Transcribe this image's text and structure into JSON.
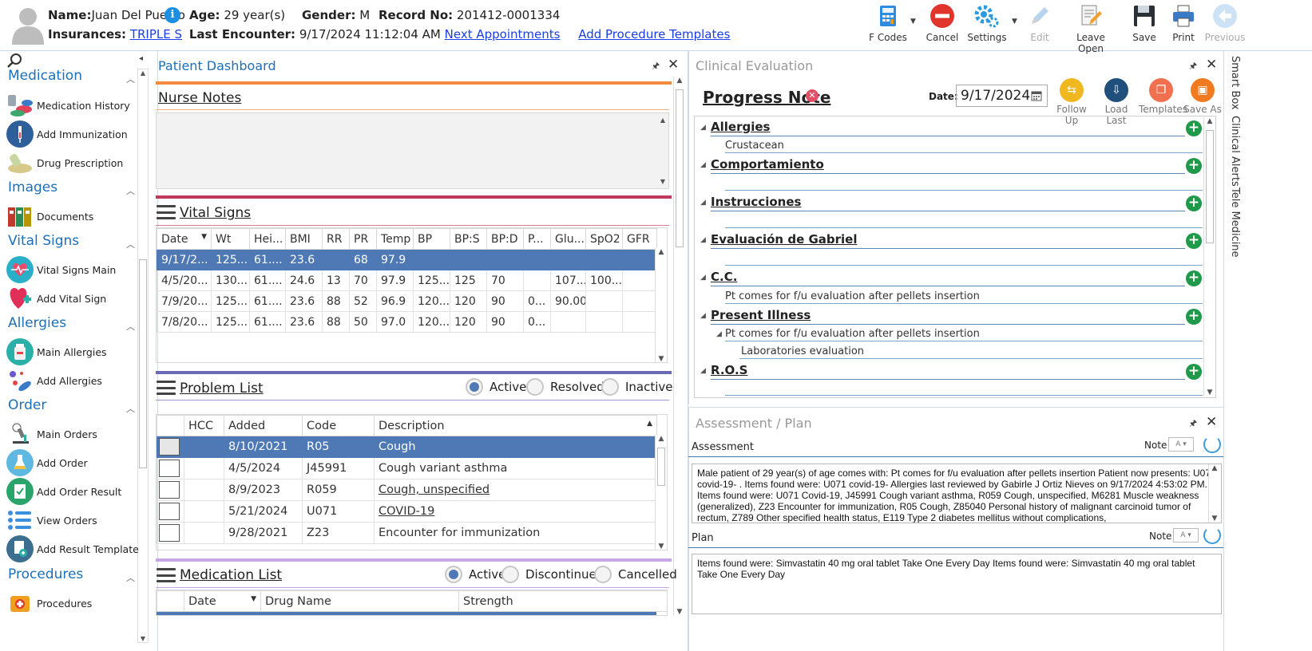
{
  "header": {
    "name_label": "Name:",
    "name": "Juan Del Pueblo",
    "age_label": "Age:",
    "age": "29 year(s)",
    "gender_label": "Gender:",
    "gender": "M",
    "record_label": "Record No:",
    "record": "201412-0001334",
    "insurances_label": "Insurances:",
    "insurance": "TRIPLE S",
    "last_encounter_label": "Last Encounter:",
    "last_encounter": "9/17/2024 11:12:04 AM",
    "next_appointments": "Next Appointments",
    "add_procedure_templates": "Add Procedure Templates"
  },
  "toolbar": {
    "fcodes": "F Codes",
    "cancel": "Cancel",
    "settings": "Settings",
    "edit": "Edit",
    "leave_open": "Leave Open",
    "save": "Save",
    "print": "Print",
    "previous": "Previous"
  },
  "sidebar": {
    "medication": {
      "title": "Medication",
      "items": [
        "Medication History",
        "Add Immunization",
        "Drug Prescription"
      ]
    },
    "images": {
      "title": "Images",
      "items": [
        "Documents"
      ]
    },
    "vital_signs": {
      "title": "Vital Signs",
      "items": [
        "Vital Signs Main",
        "Add Vital Sign"
      ]
    },
    "allergies": {
      "title": "Allergies",
      "items": [
        "Main Allergies",
        "Add Allergies"
      ]
    },
    "order": {
      "title": "Order",
      "items": [
        "Main Orders",
        "Add Order",
        "Add Order Result",
        "View Orders",
        "Add Result Template"
      ]
    },
    "procedures": {
      "title": "Procedures",
      "items": [
        "Procedures"
      ]
    }
  },
  "dashboard": {
    "title": "Patient Dashboard",
    "nurse_notes": "Nurse Notes",
    "vital_signs": {
      "title": "Vital Signs",
      "columns": [
        "Date",
        "Wt",
        "Hei...",
        "BMI",
        "RR",
        "PR",
        "Temp",
        "BP",
        "BP:S",
        "BP:D",
        "P...",
        "Glu...",
        "SpO2",
        "GFR"
      ],
      "rows": [
        [
          "9/17/2...",
          "125...",
          "61....",
          "23.6",
          "",
          "68",
          "97.9",
          "",
          "",
          "",
          "",
          "",
          "",
          ""
        ],
        [
          "4/5/20...",
          "130...",
          "61....",
          "24.6",
          "13",
          "70",
          "97.9",
          "125...",
          "125",
          "70",
          "",
          "107...",
          "100...",
          ""
        ],
        [
          "7/9/20...",
          "125...",
          "61....",
          "23.6",
          "88",
          "52",
          "96.9",
          "120...",
          "120",
          "90",
          "0...",
          "90.00",
          "",
          ""
        ],
        [
          "7/8/20...",
          "125...",
          "61....",
          "23.6",
          "88",
          "50",
          "97.0",
          "120...",
          "120",
          "90",
          "0...",
          "",
          "",
          ""
        ]
      ]
    },
    "problem_list": {
      "title": "Problem List",
      "filters": [
        "Active",
        "Resolved",
        "Inactive"
      ],
      "columns": [
        "HCC",
        "Added",
        "Code",
        "Description"
      ],
      "rows": [
        [
          "",
          "8/10/2021",
          "R05",
          "Cough"
        ],
        [
          "",
          "4/5/2024",
          "J45991",
          "Cough variant asthma"
        ],
        [
          "",
          "8/9/2023",
          "R059",
          "Cough, unspecified"
        ],
        [
          "",
          "5/21/2024",
          "U071",
          "COVID-19"
        ],
        [
          "",
          "9/28/2021",
          "Z23",
          "Encounter for immunization"
        ]
      ]
    },
    "medication_list": {
      "title": "Medication List",
      "filters": [
        "Active",
        "Discontinued",
        "Cancelled"
      ],
      "columns": [
        "Date",
        "Drug Name",
        "Strength"
      ]
    }
  },
  "clinical": {
    "title": "Clinical Evaluation",
    "note_title": "Progress Note",
    "date_label": "Date:",
    "date": "9/17/2024",
    "actions": [
      "Follow Up",
      "Load Last",
      "Templates",
      "Save As"
    ],
    "sections": {
      "allergies": "Allergies",
      "allergies_value": "Crustacean",
      "comportamiento": "Comportamiento",
      "instrucciones": "Instrucciones",
      "evaluacion": "Evaluación de Gabriel",
      "cc": "C.C.",
      "cc_value": "Pt comes for f/u evaluation after pellets insertion",
      "present_illness": "Present Illness",
      "pi_value": "Pt comes for f/u evaluation after pellets insertion",
      "pi_sub": "Laboratories evaluation",
      "ros": "R.O.S"
    }
  },
  "assessment": {
    "title": "Assessment / Plan",
    "assessment_label": "Assessment",
    "note_label": "Note",
    "assessment_text": "Male patient of 29 year(s) of age comes with:  Pt comes for f/u evaluation after pellets insertion  Patient now presents: U071 covid-19- . Items found were:  U071 covid-19-    Allergies last reviewed by Gabirle J Ortiz Nieves on 9/17/2024 4:53:02 PM.     Items found were:  U071 Covid-19, J45991 Cough variant asthma, R059 Cough, unspecified, M6281 Muscle weakness (generalized), Z23 Encounter for immunization, R05 Cough, Z85040 Personal history of malignant carcinoid tumor of rectum, Z789 Other specified health status, E119 Type 2 diabetes mellitus without complications,",
    "plan_label": "Plan",
    "plan_text": "  Items found were:  Simvastatin 40 mg oral tablet Take One Every Day   Items found were:  Simvastatin 40 mg oral tablet Take One Every Day"
  },
  "rail": [
    "Smart Box",
    "Clinical Alerts",
    "Tele Medicine"
  ]
}
